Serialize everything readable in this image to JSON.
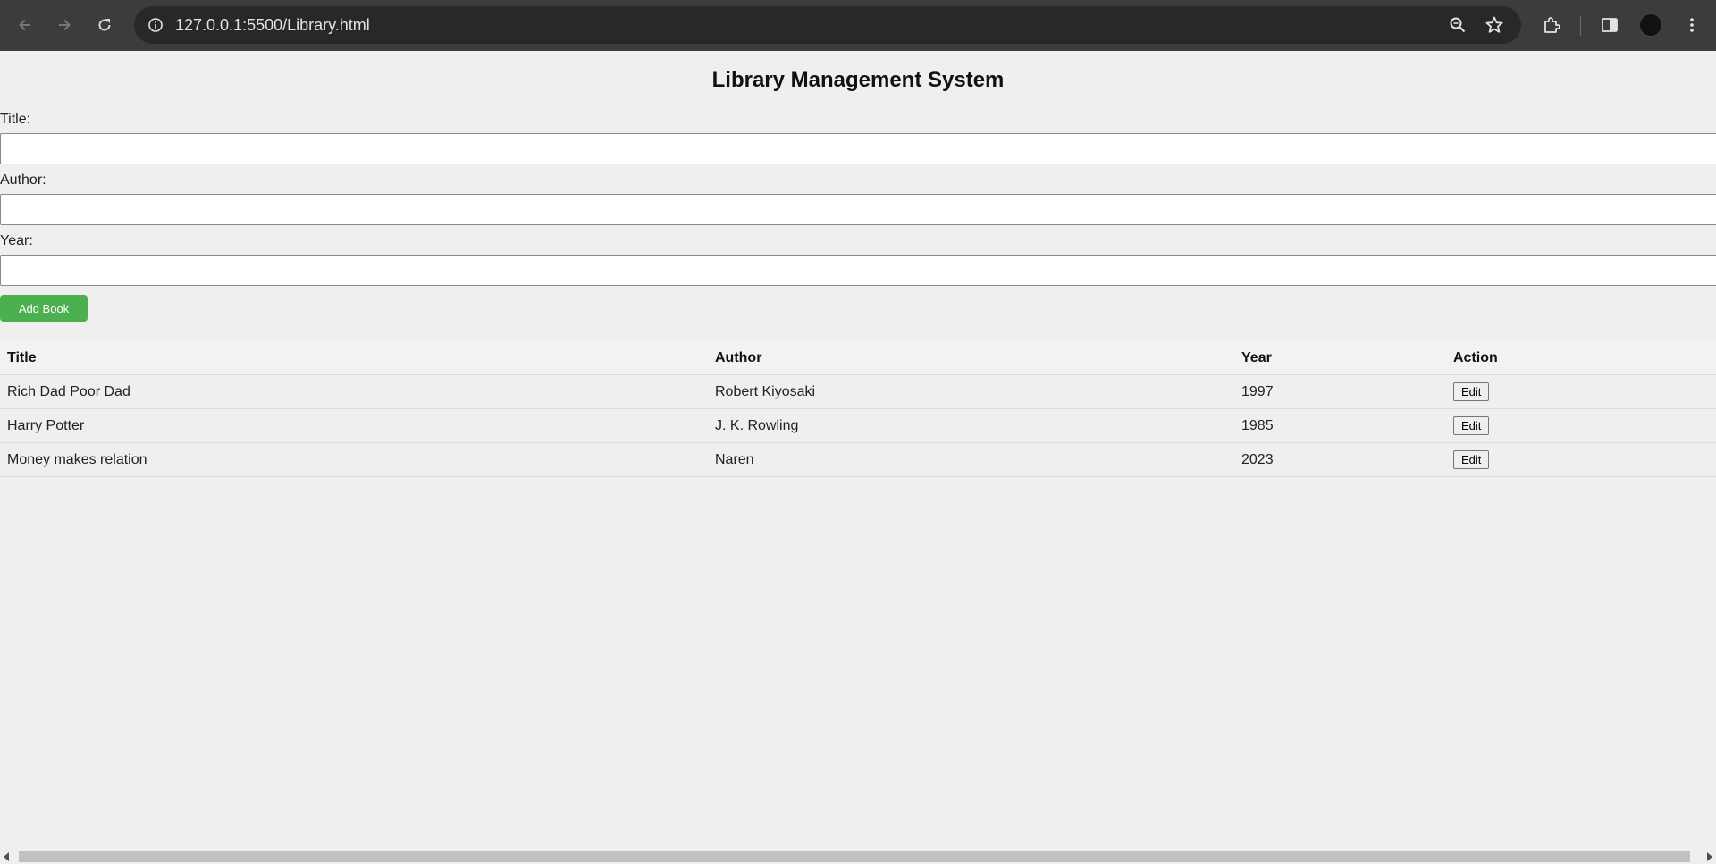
{
  "browser": {
    "url": "127.0.0.1:5500/Library.html",
    "icons": [
      "back-icon",
      "forward-icon",
      "reload-icon",
      "site-info-icon",
      "zoom-icon",
      "bookmark-star-icon",
      "extensions-icon",
      "side-panel-icon",
      "profile-avatar",
      "menu-icon"
    ]
  },
  "page": {
    "title": "Library Management System",
    "form": {
      "title_label": "Title:",
      "title_value": "",
      "author_label": "Author:",
      "author_value": "",
      "year_label": "Year:",
      "year_value": "",
      "add_button": "Add Book",
      "add_button_color": "#4caf50"
    },
    "table": {
      "headers": [
        "Title",
        "Author",
        "Year",
        "Action"
      ],
      "rows": [
        {
          "title": "Rich Dad Poor Dad",
          "author": "Robert Kiyosaki",
          "year": "1997",
          "action": "Edit"
        },
        {
          "title": "Harry Potter",
          "author": "J. K. Rowling",
          "year": "1985",
          "action": "Edit"
        },
        {
          "title": "Money makes relation",
          "author": "Naren",
          "year": "2023",
          "action": "Edit"
        }
      ]
    }
  }
}
